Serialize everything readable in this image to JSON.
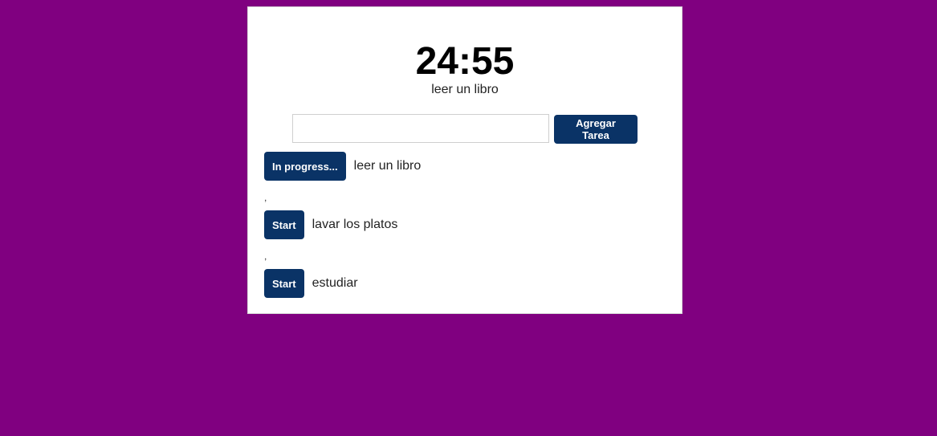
{
  "colors": {
    "background": "#800080",
    "button": "#0a3366"
  },
  "timer": {
    "display": "24:55",
    "current_task": "leer un libro"
  },
  "form": {
    "input_value": "",
    "add_button_label": "Agregar Tarea"
  },
  "tasks": [
    {
      "action_label": "In progress...",
      "name": "leer un libro"
    },
    {
      "action_label": "Start",
      "name": "lavar los platos"
    },
    {
      "action_label": "Start",
      "name": "estudiar"
    }
  ],
  "separators": [
    ",",
    ","
  ]
}
